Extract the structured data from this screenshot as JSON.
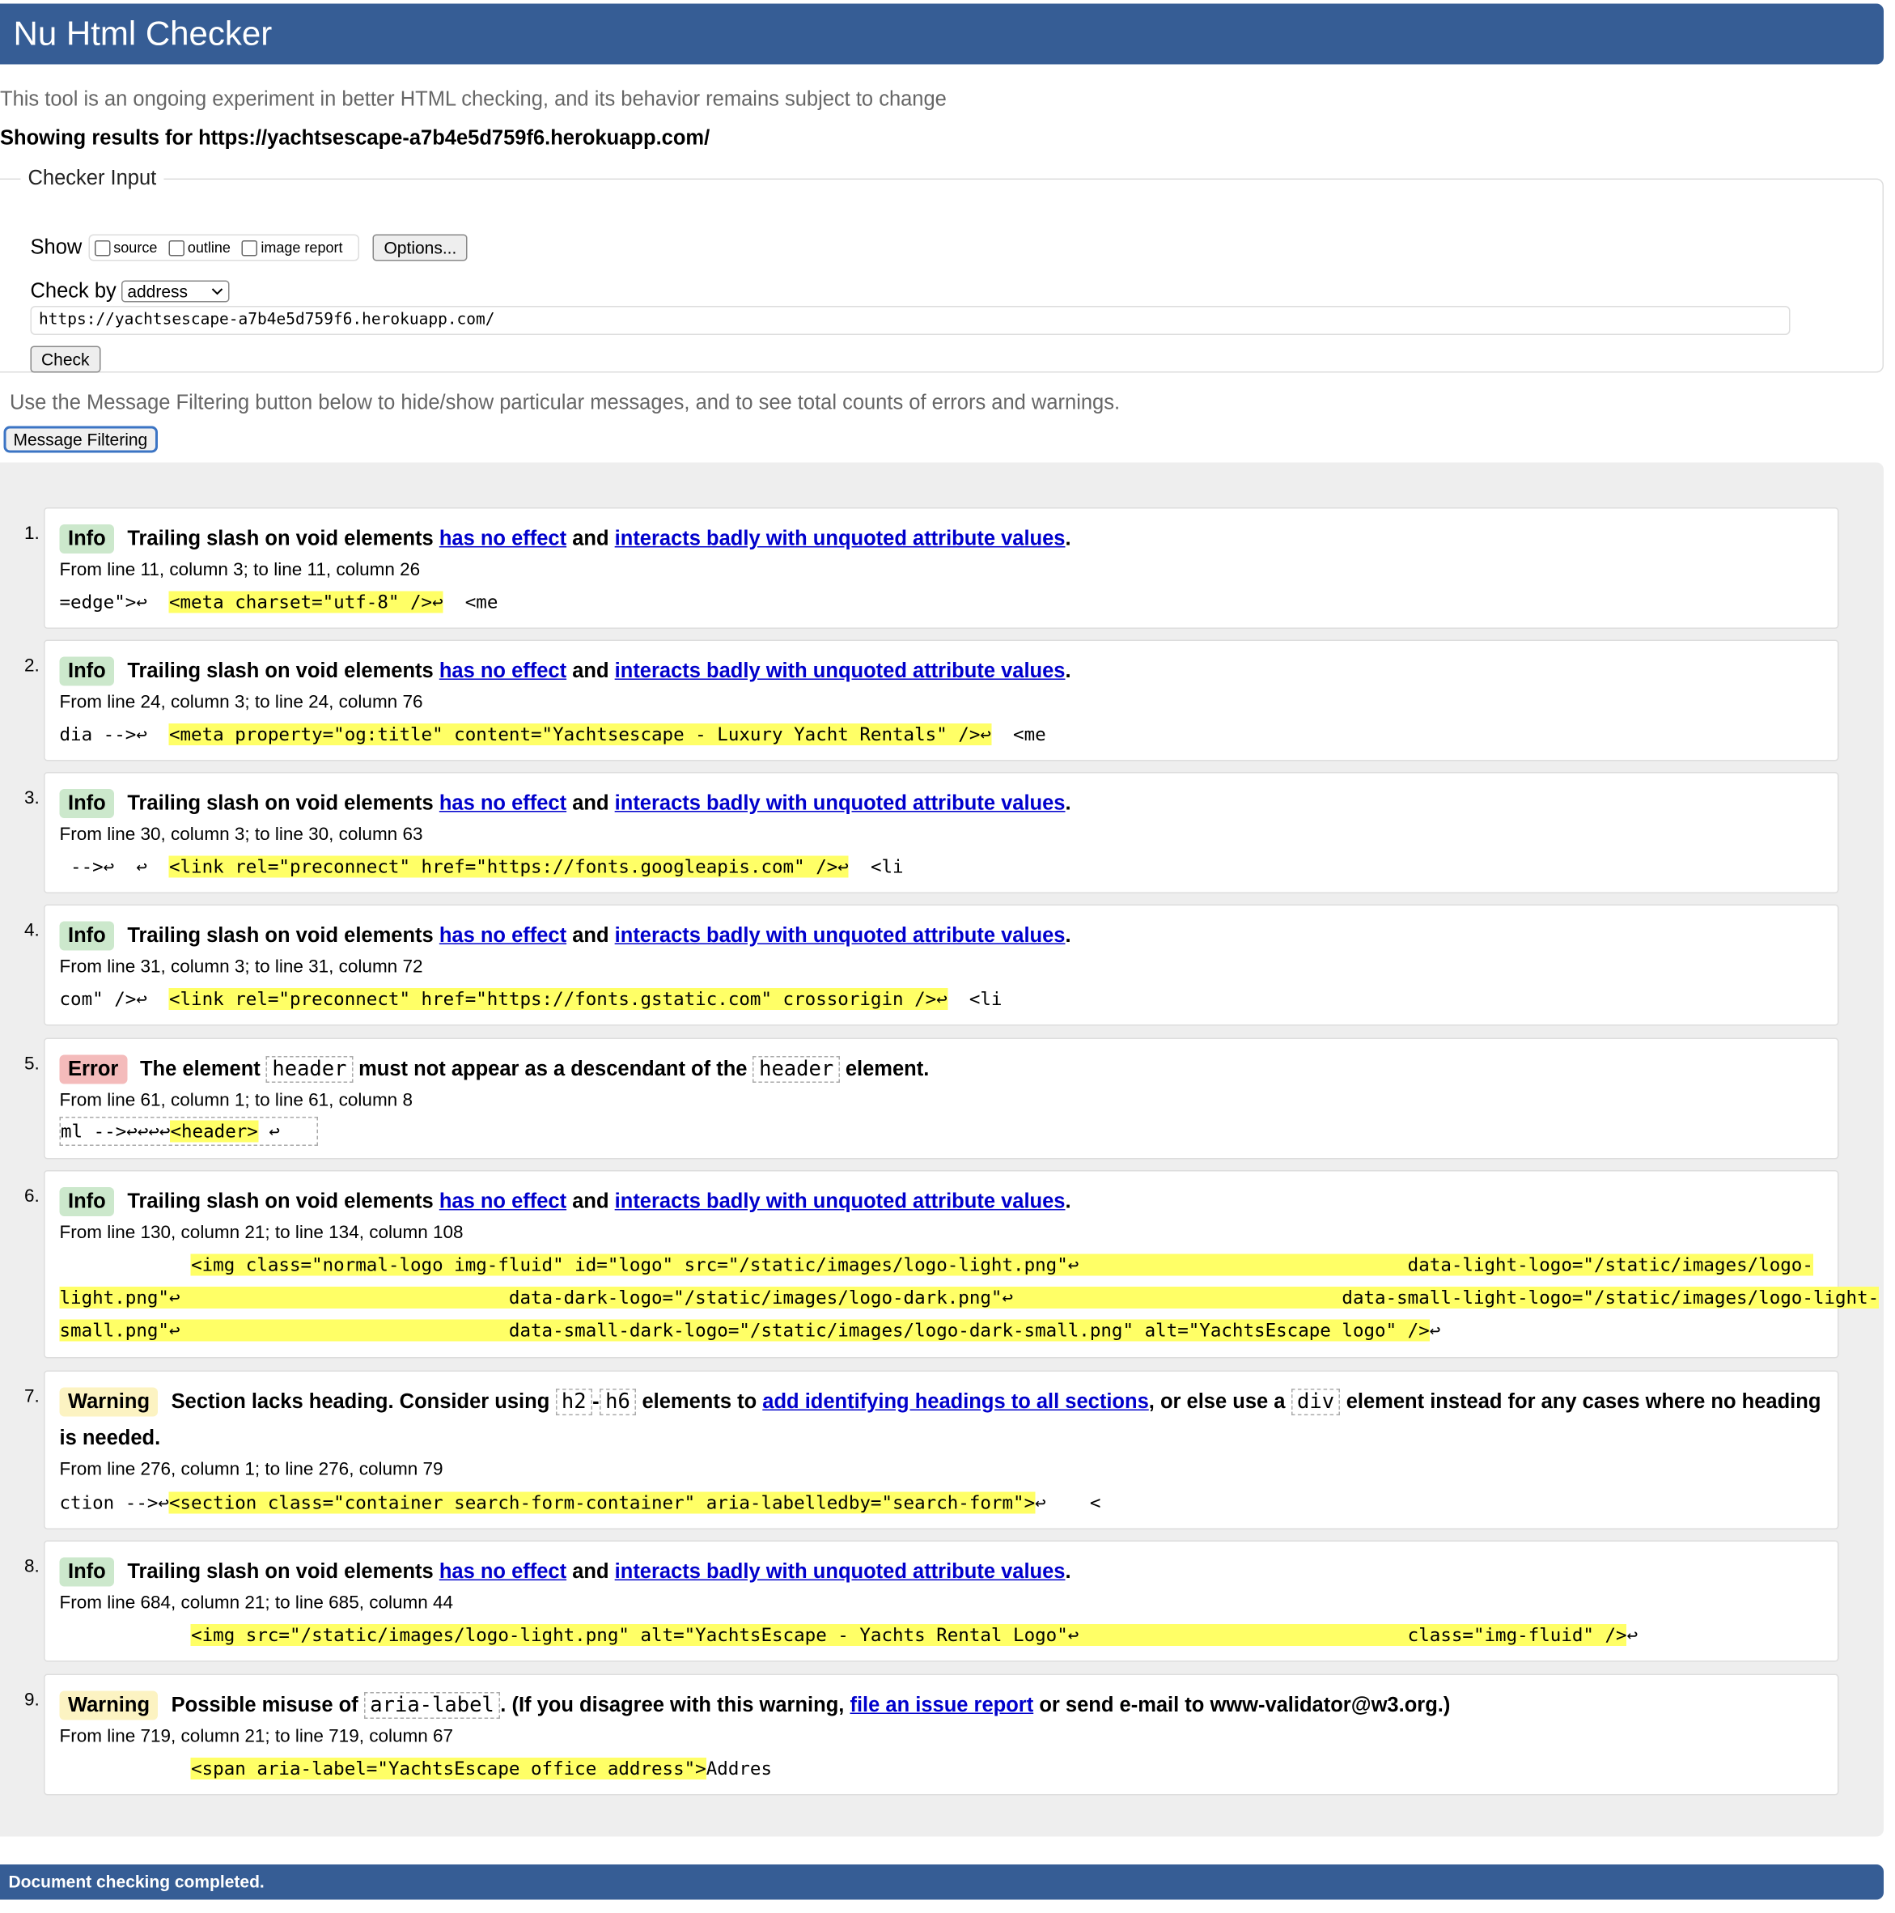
{
  "header": {
    "title": "Nu Html Checker"
  },
  "intro": "This tool is an ongoing experiment in better HTML checking, and its behavior remains subject to change",
  "showing": "Showing results for https://yachtsescape-a7b4e5d759f6.herokuapp.com/",
  "checker_input": {
    "legend": "Checker Input",
    "show_label": "Show",
    "checkboxes": [
      "source",
      "outline",
      "image report"
    ],
    "options_button": "Options...",
    "check_by_label": "Check by",
    "check_by_value": "address",
    "url_value": "https://yachtsescape-a7b4e5d759f6.herokuapp.com/",
    "check_button": "Check"
  },
  "filter_note": "Use the Message Filtering button below to hide/show particular messages, and to see total counts of errors and warnings.",
  "message_filtering_button": "Message Filtering",
  "common": {
    "info": "Info",
    "error": "Error",
    "warning": "Warning",
    "trailing_slash": "Trailing slash on void elements",
    "has_no_effect": "has no effect",
    "and": "and",
    "interacts_badly": "interacts badly with unquoted attribute values",
    "period": "."
  },
  "messages": [
    {
      "num": "1.",
      "location": "From line 11, column 3; to line 11, column 26",
      "extract_pre": "=edge\">↩  ",
      "extract_hl": "<meta charset=\"utf-8\" />↩",
      "extract_post": "  <me"
    },
    {
      "num": "2.",
      "location": "From line 24, column 3; to line 24, column 76",
      "extract_pre": "dia -->↩  ",
      "extract_hl": "<meta property=\"og:title\" content=\"Yachtsescape - Luxury Yacht Rentals\" />↩",
      "extract_post": "  <me"
    },
    {
      "num": "3.",
      "location": "From line 30, column 3; to line 30, column 63",
      "extract_pre": " -->↩  ↩  ",
      "extract_hl": "<link rel=\"preconnect\" href=\"https://fonts.googleapis.com\" />↩",
      "extract_post": "  <li"
    },
    {
      "num": "4.",
      "location": "From line 31, column 3; to line 31, column 72",
      "extract_pre": "com\" />↩  ",
      "extract_hl": "<link rel=\"preconnect\" href=\"https://fonts.gstatic.com\" crossorigin />↩",
      "extract_post": "  <li"
    },
    {
      "num": "5.",
      "text_pre": "The element",
      "code1": "header",
      "text_mid": "must not appear as a descendant of the",
      "code2": "header",
      "text_post": "element.",
      "location": "From line 61, column 1; to line 61, column 8",
      "extract_pre": "ml -->↩↩↩↩",
      "extract_hl": "<header>",
      "extract_post": " ↩"
    },
    {
      "num": "6.",
      "location": "From line 130, column 21; to line 134, column 108",
      "extract_l1_pre": "            ",
      "extract_l1_hl": "<img class=\"normal-logo img-fluid\" id=\"logo\" src=\"/static/images/logo-light.png\"↩                              data-light-logo=\"/static/images/logo-",
      "extract_l2_hl": "light.png\"↩                              data-dark-logo=\"/static/images/logo-dark.png\"↩                              data-small-light-logo=\"/static/images/logo-light-",
      "extract_l3_hl": "small.png\"↩                              data-small-dark-logo=\"/static/images/logo-dark-small.png\" alt=\"YachtsEscape logo\" />",
      "extract_l3_post": "↩"
    },
    {
      "num": "7.",
      "text_pre": "Section lacks heading. Consider using",
      "code1": "h2",
      "dash": "-",
      "code2": "h6",
      "text_mid": "elements to",
      "link": "add identifying headings to all sections",
      "text_mid2": ", or else use a",
      "code3": "div",
      "text_post": "element instead for any cases where no heading is needed.",
      "location": "From line 276, column 1; to line 276, column 79",
      "extract_pre": "ction -->↩",
      "extract_hl": "<section class=\"container search-form-container\" aria-labelledby=\"search-form\">",
      "extract_post": "↩    <"
    },
    {
      "num": "8.",
      "location": "From line 684, column 21; to line 685, column 44",
      "extract_pre": "            ",
      "extract_hl": "<img src=\"/static/images/logo-light.png\" alt=\"YachtsEscape - Yachts Rental Logo\"↩                              class=\"img-fluid\" />",
      "extract_post": "↩"
    },
    {
      "num": "9.",
      "text_pre": "Possible misuse of",
      "code1": "aria-label",
      "text_mid": ". (If you disagree with this warning,",
      "link": "file an issue report",
      "text_post": "or send e-mail to www-validator@w3.org.)",
      "location": "From line 719, column 21; to line 719, column 67",
      "extract_pre": "            ",
      "extract_hl": "<span aria-label=\"YachtsEscape office address\">",
      "extract_post": "Addres"
    }
  ],
  "footer": "Document checking completed."
}
